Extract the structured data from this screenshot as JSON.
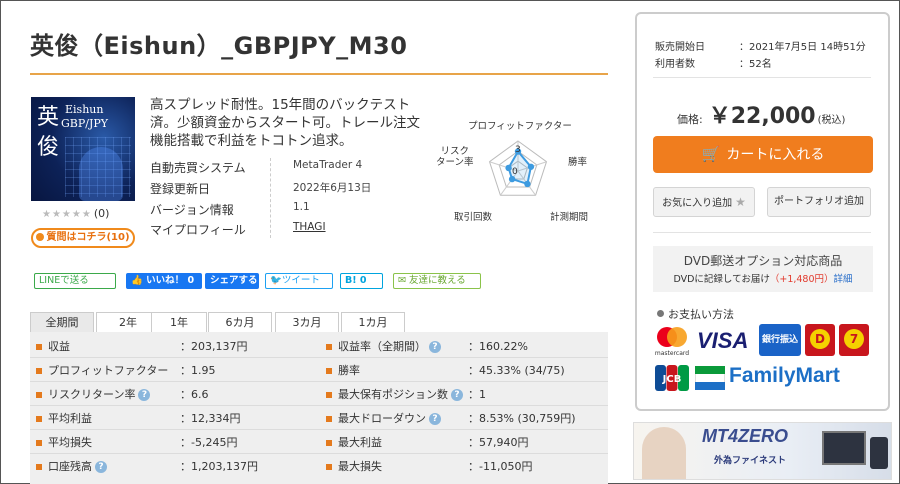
{
  "title": "英俊（Eishun）_GBPJPY_M30",
  "cover": {
    "line1": "Eishun",
    "line2": "GBP/JPY",
    "kanji": "英俊"
  },
  "rating": {
    "stars": "★★★★★",
    "count": "(0)"
  },
  "inquiry_label": "質問はコチラ(10)",
  "description": "高スプレッド耐性。15年間のバックテスト済。少額資金からスタート可。トレール注文機能搭載で利益をトコトン追求。",
  "info": [
    {
      "key": "自動売買システム",
      "value": "MetaTrader 4"
    },
    {
      "key": "登録更新日",
      "value": "2022年6月13日"
    },
    {
      "key": "バージョン情報",
      "value": "1.1"
    },
    {
      "key": "マイプロフィール",
      "value": "THAGI"
    }
  ],
  "radar": {
    "labels": {
      "top": "プロフィットファクター",
      "right": "勝率",
      "bottom_right": "計測期間",
      "bottom_left": "取引回数",
      "left": "リスク\nターン率"
    },
    "ticks": [
      "3",
      "0"
    ],
    "values": {
      "profit_factor": 1.95,
      "win_rate": 45.33,
      "period": 1.6,
      "trades": 1.0,
      "risk_return": 6.6
    },
    "accent": "#3d9be0"
  },
  "social": {
    "line": "LINEで送る",
    "like": "いいね！ 0",
    "share": "シェアする",
    "tweet": "ツイート",
    "hatena": "B! 0",
    "friend": "友達に教える"
  },
  "tabs": [
    "全期間",
    "2年",
    "1年",
    "6カ月",
    "3カ月",
    "1カ月"
  ],
  "stats_left": [
    {
      "label": "収益",
      "value": "：203,137円",
      "help": false
    },
    {
      "label": "プロフィットファクター",
      "value": "：1.95",
      "help": false
    },
    {
      "label": "リスクリターン率",
      "value": "：6.6",
      "help": true
    },
    {
      "label": "平均利益",
      "value": "：12,334円",
      "help": false
    },
    {
      "label": "平均損失",
      "value": "：-5,245円",
      "help": false
    },
    {
      "label": "口座残高",
      "value": "：1,203,137円",
      "help": true
    }
  ],
  "stats_right": [
    {
      "label": "収益率（全期間）",
      "value": "：160.22%",
      "help": true
    },
    {
      "label": "勝率",
      "value": "：45.33% (34/75)",
      "help": false
    },
    {
      "label": "最大保有ポジション数",
      "value": "：1",
      "help": true
    },
    {
      "label": "最大ドローダウン",
      "value": "：8.53% (30,759円)",
      "help": true
    },
    {
      "label": "最大利益",
      "value": "：57,940円",
      "help": false
    },
    {
      "label": "最大損失",
      "value": "：-11,050円",
      "help": false
    }
  ],
  "panel": {
    "sale_start_label": "販売開始日",
    "sale_start_value": "：2021年7月5日 14時51分",
    "users_label": "利用者数",
    "users_value": "：52名",
    "price_label": "価格:",
    "price": "￥22,000",
    "tax": "(税込)",
    "cart_label": "カートに入れる",
    "favorite_label": "お気に入り追加",
    "portfolio_label": "ポートフォリオ追加",
    "dvd_title": "DVD郵送オプション対応商品",
    "dvd_note": "DVDに記録してお届け",
    "dvd_price": "（+1,480円）",
    "dvd_link": "詳細",
    "payment_title": "お支払い方法",
    "payment_logos": {
      "mastercard": "mastercard",
      "visa": "VISA",
      "bank": "銀行振込",
      "familymart": "FamilyMart",
      "jcb": "JCB"
    }
  },
  "banner": {
    "title": "MT4ZERO",
    "subtitle": "外為ファイネスト"
  },
  "colors": {
    "accent_orange": "#f07d1e",
    "title_rule": "#e8a449",
    "bullet": "#e47a1d"
  }
}
